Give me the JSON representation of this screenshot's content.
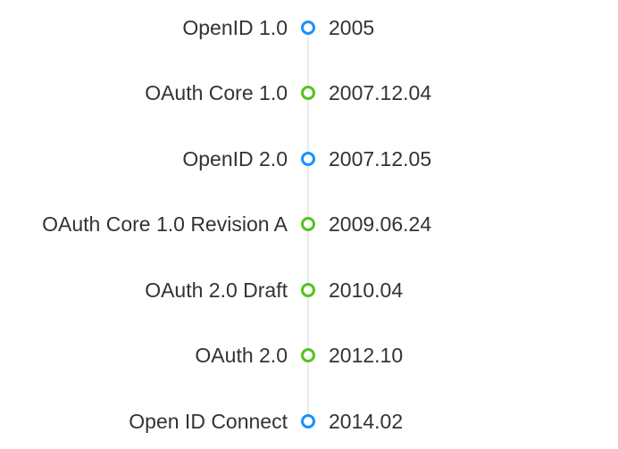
{
  "colors": {
    "blue": "#1890ff",
    "green": "#52c41a",
    "axis": "#ebebeb",
    "text": "#333333"
  },
  "items": [
    {
      "label": "OpenID 1.0",
      "date": "2005",
      "color": "blue"
    },
    {
      "label": "OAuth Core 1.0",
      "date": "2007.12.04",
      "color": "green"
    },
    {
      "label": "OpenID 2.0",
      "date": "2007.12.05",
      "color": "blue"
    },
    {
      "label": "OAuth Core 1.0 Revision A",
      "date": "2009.06.24",
      "color": "green"
    },
    {
      "label": "OAuth 2.0 Draft",
      "date": "2010.04",
      "color": "green"
    },
    {
      "label": "OAuth 2.0",
      "date": "2012.10",
      "color": "green"
    },
    {
      "label": "Open ID Connect",
      "date": "2014.02",
      "color": "blue"
    }
  ]
}
